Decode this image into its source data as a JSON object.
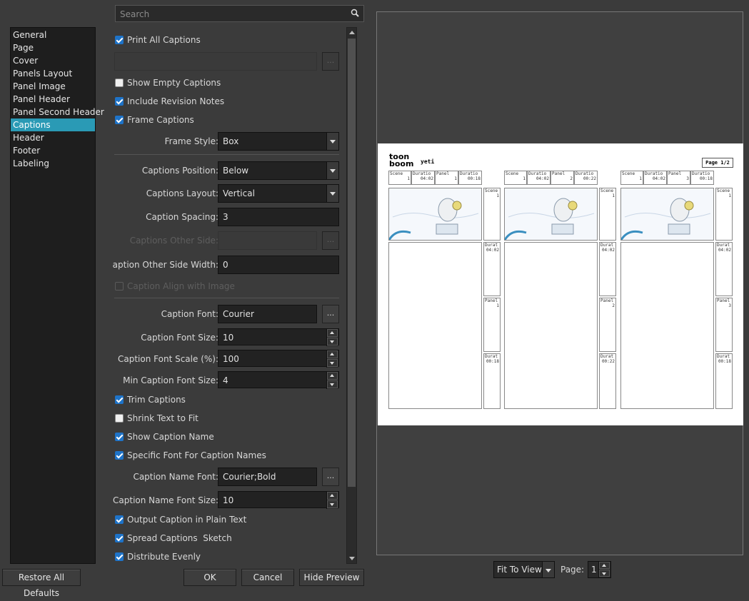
{
  "search": {
    "placeholder": "Search"
  },
  "categories": [
    {
      "label": "General"
    },
    {
      "label": "Page"
    },
    {
      "label": "Cover"
    },
    {
      "label": "Panels Layout"
    },
    {
      "label": "Panel Image"
    },
    {
      "label": "Panel Header"
    },
    {
      "label": "Panel Second Header"
    },
    {
      "label": "Captions",
      "selected": true
    },
    {
      "label": "Header"
    },
    {
      "label": "Footer"
    },
    {
      "label": "Labeling"
    }
  ],
  "form": {
    "print_all_captions": {
      "label": "Print All Captions",
      "checked": true
    },
    "caption_list_button": "...",
    "show_empty_captions": {
      "label": "Show Empty Captions",
      "checked": false
    },
    "include_revision_notes": {
      "label": "Include Revision Notes",
      "checked": true
    },
    "frame_captions": {
      "label": "Frame Captions",
      "checked": true
    },
    "frame_style": {
      "label": "Frame Style:",
      "value": "Box"
    },
    "captions_position": {
      "label": "Captions Position:",
      "value": "Below"
    },
    "captions_layout": {
      "label": "Captions Layout:",
      "value": "Vertical"
    },
    "caption_spacing": {
      "label": "Caption Spacing:",
      "value": "3"
    },
    "captions_other_side": {
      "label": "Captions Other Side:",
      "value": "",
      "button": "..."
    },
    "caption_other_side_width": {
      "label": "Caption Other Side Width:",
      "value": "0"
    },
    "caption_align_with_image": {
      "label": "Caption Align with Image",
      "checked": false
    },
    "caption_font": {
      "label": "Caption Font:",
      "value": "Courier",
      "button": "..."
    },
    "caption_font_size": {
      "label": "Caption Font Size:",
      "value": "10"
    },
    "caption_font_scale": {
      "label": "Caption Font Scale (%):",
      "value": "100"
    },
    "min_caption_font_size": {
      "label": "Min Caption Font Size:",
      "value": "4"
    },
    "trim_captions": {
      "label": "Trim Captions",
      "checked": true
    },
    "shrink_text_to_fit": {
      "label": "Shrink Text to Fit",
      "checked": false
    },
    "show_caption_name": {
      "label": "Show Caption Name",
      "checked": true
    },
    "specific_font_for_caption_names": {
      "label": "Specific Font For Caption Names",
      "checked": true
    },
    "caption_name_font": {
      "label": "Caption Name Font:",
      "value": "Courier;Bold",
      "button": "..."
    },
    "caption_name_font_size": {
      "label": "Caption Name Font Size:",
      "value": "10"
    },
    "output_caption_plain_text": {
      "label": "Output Caption in Plain Text",
      "checked": true
    },
    "spread_captions_sketch": {
      "label": "Spread Captions  Sketch",
      "checked": true
    },
    "distribute_evenly": {
      "label": "Distribute Evenly",
      "checked": true
    }
  },
  "preview_page": {
    "logo_top": "toon",
    "logo_bottom": "boom",
    "project": "yeti",
    "page_indicator": "Page 1/2",
    "header_labels": [
      "Scene",
      "Duratio",
      "Panel",
      "Duratio"
    ],
    "panels": [
      {
        "scene": "1",
        "duration": "04:02",
        "panel": "1",
        "panel_duration": "00:18",
        "side": [
          {
            "label": "Scene",
            "value": "1"
          },
          {
            "label": "Durat",
            "value": "04:02"
          },
          {
            "label": "Panel",
            "value": "1"
          },
          {
            "label": "Durat",
            "value": "00:18"
          }
        ]
      },
      {
        "scene": "1",
        "duration": "04:02",
        "panel": "2",
        "panel_duration": "00:22",
        "side": [
          {
            "label": "Scene",
            "value": "1"
          },
          {
            "label": "Durat",
            "value": "04:02"
          },
          {
            "label": "Panel",
            "value": "2"
          },
          {
            "label": "Durat",
            "value": "00:22"
          }
        ]
      },
      {
        "scene": "1",
        "duration": "04:02",
        "panel": "3",
        "panel_duration": "00:18",
        "side": [
          {
            "label": "Scene",
            "value": "1"
          },
          {
            "label": "Durat",
            "value": "04:02"
          },
          {
            "label": "Panel",
            "value": "3"
          },
          {
            "label": "Durat",
            "value": "00:18"
          }
        ]
      }
    ]
  },
  "footer": {
    "restore_defaults": "Restore All Defaults",
    "ok": "OK",
    "cancel": "Cancel",
    "hide_preview": "Hide Preview",
    "zoom_mode": "Fit To View",
    "page_label": "Page:",
    "page_value": "1"
  }
}
